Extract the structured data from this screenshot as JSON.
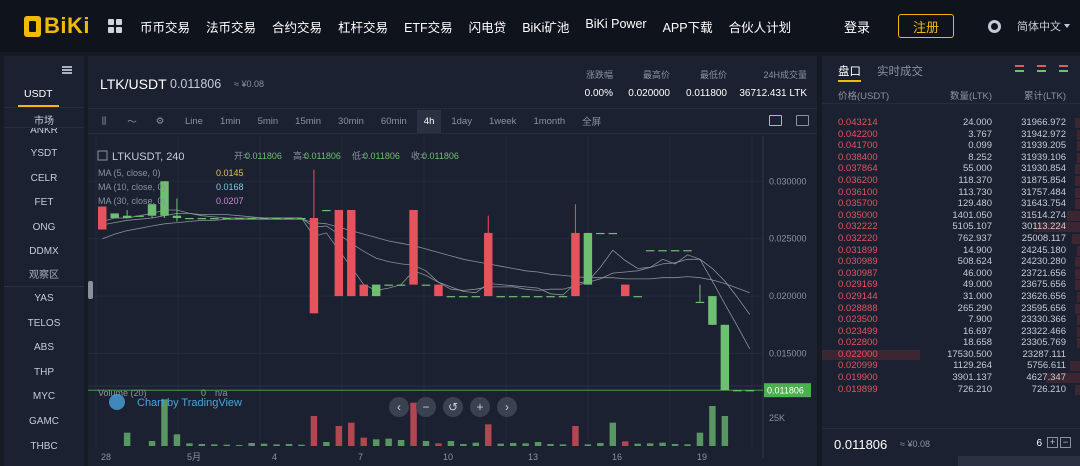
{
  "brand": {
    "name": "BiKi"
  },
  "nav": [
    "币币交易",
    "法币交易",
    "合约交易",
    "杠杆交易",
    "ETF交易",
    "闪电贷",
    "BiKi矿池",
    "BiKi Power",
    "APP下载",
    "合伙人计划"
  ],
  "header": {
    "login": "登录",
    "register": "注册",
    "language": "简体中文"
  },
  "markets": {
    "tab": "USDT",
    "section_label": "市场",
    "items": [
      "ANKR",
      "YSDT",
      "CELR",
      "FET",
      "ONG",
      "DDMX"
    ],
    "watch_label": "观察区",
    "watch_items": [
      "YAS",
      "TELOS",
      "ABS",
      "THP",
      "MYC",
      "GAMC",
      "THBC"
    ]
  },
  "ticker": {
    "pair": "LTK/USDT",
    "price": "0.011806",
    "cny": "≈ ¥0.08",
    "stats": [
      {
        "label": "涨跌幅",
        "value": "0.00%"
      },
      {
        "label": "最高价",
        "value": "0.020000"
      },
      {
        "label": "最低价",
        "value": "0.011800"
      },
      {
        "label": "24H成交量",
        "value": "36712.431 LTK"
      }
    ]
  },
  "toolbar": {
    "intervals": [
      "Line",
      "1min",
      "5min",
      "15min",
      "30min",
      "60min",
      "4h",
      "1day",
      "1week",
      "1month"
    ],
    "active": "4h",
    "fullscreen": "全屏"
  },
  "chart_legend": {
    "symbol": "LTKUSDT, 240",
    "ohlc": [
      {
        "k": "开=",
        "v": "0.011806"
      },
      {
        "k": "高=",
        "v": "0.011806"
      },
      {
        "k": "低=",
        "v": "0.011806"
      },
      {
        "k": "收=",
        "v": "0.011806"
      }
    ],
    "ma": [
      {
        "label": "MA (5, close, 0)",
        "value": "0.0145",
        "color": "#e0c35a"
      },
      {
        "label": "MA (10, close, 0)",
        "value": "0.0168",
        "color": "#7ec9e6"
      },
      {
        "label": "MA (30, close, 0)",
        "value": "0.0207",
        "color": "#c88bd9"
      }
    ],
    "volume": {
      "label": "Volume (20)",
      "value": "0",
      "na": "n/a"
    }
  },
  "chart_data": {
    "type": "candlestick",
    "y_ticks": [
      "0.030000",
      "0.025000",
      "0.020000",
      "0.015000"
    ],
    "y_values": [
      0.03,
      0.025,
      0.02,
      0.015
    ],
    "last_price": "0.011806",
    "last_price_value": 0.011806,
    "volume_tick": "25K",
    "x_ticks": [
      "28",
      "5月",
      "4",
      "7",
      "10",
      "13",
      "16",
      "19"
    ],
    "candles": [
      {
        "o": 0.0278,
        "c": 0.0258,
        "h": 0.0278,
        "l": 0.0258
      },
      {
        "o": 0.0268,
        "c": 0.0272,
        "h": 0.0272,
        "l": 0.0268
      },
      {
        "o": 0.0268,
        "c": 0.027,
        "h": 0.0275,
        "l": 0.0268
      },
      {
        "o": 0.027,
        "c": 0.027,
        "h": 0.027,
        "l": 0.027
      },
      {
        "o": 0.027,
        "c": 0.028,
        "h": 0.028,
        "l": 0.0268
      },
      {
        "o": 0.027,
        "c": 0.03,
        "h": 0.03,
        "l": 0.0268
      },
      {
        "o": 0.0268,
        "c": 0.027,
        "h": 0.0285,
        "l": 0.0265
      },
      {
        "o": 0.0268,
        "c": 0.0268,
        "h": 0.0268,
        "l": 0.0268
      },
      {
        "o": 0.0268,
        "c": 0.0268,
        "h": 0.0268,
        "l": 0.0268
      },
      {
        "o": 0.0268,
        "c": 0.0268,
        "h": 0.0268,
        "l": 0.0268
      },
      {
        "o": 0.0268,
        "c": 0.0268,
        "h": 0.0268,
        "l": 0.0268
      },
      {
        "o": 0.0268,
        "c": 0.0268,
        "h": 0.0268,
        "l": 0.0268
      },
      {
        "o": 0.0268,
        "c": 0.0268,
        "h": 0.0268,
        "l": 0.0268
      },
      {
        "o": 0.0268,
        "c": 0.0268,
        "h": 0.0268,
        "l": 0.0268
      },
      {
        "o": 0.0268,
        "c": 0.0268,
        "h": 0.0268,
        "l": 0.0268
      },
      {
        "o": 0.0268,
        "c": 0.0268,
        "h": 0.0268,
        "l": 0.0268
      },
      {
        "o": 0.0268,
        "c": 0.0268,
        "h": 0.0268,
        "l": 0.0268
      },
      {
        "o": 0.0268,
        "c": 0.0185,
        "h": 0.031,
        "l": 0.0185
      },
      {
        "o": 0.0275,
        "c": 0.0275,
        "h": 0.0275,
        "l": 0.0275
      },
      {
        "o": 0.0275,
        "c": 0.02,
        "h": 0.0275,
        "l": 0.02
      },
      {
        "o": 0.0275,
        "c": 0.02,
        "h": 0.0275,
        "l": 0.02
      },
      {
        "o": 0.021,
        "c": 0.02,
        "h": 0.021,
        "l": 0.02
      },
      {
        "o": 0.02,
        "c": 0.021,
        "h": 0.021,
        "l": 0.02
      },
      {
        "o": 0.021,
        "c": 0.021,
        "h": 0.021,
        "l": 0.021
      },
      {
        "o": 0.021,
        "c": 0.021,
        "h": 0.021,
        "l": 0.021
      },
      {
        "o": 0.0275,
        "c": 0.021,
        "h": 0.0275,
        "l": 0.021
      },
      {
        "o": 0.021,
        "c": 0.021,
        "h": 0.021,
        "l": 0.021
      },
      {
        "o": 0.021,
        "c": 0.02,
        "h": 0.021,
        "l": 0.02
      },
      {
        "o": 0.02,
        "c": 0.02,
        "h": 0.02,
        "l": 0.02
      },
      {
        "o": 0.02,
        "c": 0.02,
        "h": 0.02,
        "l": 0.02
      },
      {
        "o": 0.02,
        "c": 0.02,
        "h": 0.02,
        "l": 0.02
      },
      {
        "o": 0.0255,
        "c": 0.02,
        "h": 0.027,
        "l": 0.02
      },
      {
        "o": 0.02,
        "c": 0.02,
        "h": 0.02,
        "l": 0.02
      },
      {
        "o": 0.02,
        "c": 0.02,
        "h": 0.02,
        "l": 0.02
      },
      {
        "o": 0.02,
        "c": 0.02,
        "h": 0.02,
        "l": 0.02
      },
      {
        "o": 0.02,
        "c": 0.02,
        "h": 0.02,
        "l": 0.02
      },
      {
        "o": 0.02,
        "c": 0.02,
        "h": 0.02,
        "l": 0.02
      },
      {
        "o": 0.02,
        "c": 0.02,
        "h": 0.02,
        "l": 0.02
      },
      {
        "o": 0.0255,
        "c": 0.02,
        "h": 0.028,
        "l": 0.02
      },
      {
        "o": 0.021,
        "c": 0.0255,
        "h": 0.0255,
        "l": 0.021
      },
      {
        "o": 0.0255,
        "c": 0.0255,
        "h": 0.0255,
        "l": 0.0255
      },
      {
        "o": 0.0255,
        "c": 0.0255,
        "h": 0.0255,
        "l": 0.0255
      },
      {
        "o": 0.021,
        "c": 0.02,
        "h": 0.021,
        "l": 0.02
      },
      {
        "o": 0.02,
        "c": 0.02,
        "h": 0.02,
        "l": 0.02
      },
      {
        "o": 0.024,
        "c": 0.024,
        "h": 0.024,
        "l": 0.024
      },
      {
        "o": 0.024,
        "c": 0.024,
        "h": 0.024,
        "l": 0.024
      },
      {
        "o": 0.024,
        "c": 0.024,
        "h": 0.024,
        "l": 0.024
      },
      {
        "o": 0.024,
        "c": 0.024,
        "h": 0.024,
        "l": 0.024
      },
      {
        "o": 0.0195,
        "c": 0.0195,
        "h": 0.021,
        "l": 0.0195
      },
      {
        "o": 0.0175,
        "c": 0.02,
        "h": 0.02,
        "l": 0.0175
      },
      {
        "o": 0.01181,
        "c": 0.0175,
        "h": 0.0175,
        "l": 0.01181
      },
      {
        "o": 0.01181,
        "c": 0.01181,
        "h": 0.01181,
        "l": 0.01181
      },
      {
        "o": 0.01181,
        "c": 0.01181,
        "h": 0.01181,
        "l": 0.01181
      }
    ],
    "volumes": [
      0,
      0,
      4000,
      0,
      1500,
      14000,
      3500,
      800,
      600,
      500,
      400,
      300,
      900,
      700,
      500,
      600,
      400,
      9000,
      1200,
      6000,
      7000,
      2500,
      2000,
      2200,
      1800,
      13000,
      1500,
      800,
      1500,
      600,
      1000,
      6500,
      700,
      900,
      800,
      1200,
      600,
      500,
      6000,
      500,
      900,
      7000,
      1400,
      700,
      800,
      1000,
      600,
      500,
      4000,
      12000,
      9000,
      0,
      0
    ],
    "ma_series": [
      {
        "name": "MA5",
        "color": "#e0c35a",
        "values": [
          0.0265,
          0.0268,
          0.0268,
          0.027,
          0.0272,
          0.0275,
          0.0275,
          0.0272,
          0.027,
          0.0269,
          0.0268,
          0.0268,
          0.0268,
          0.0268,
          0.0268,
          0.0268,
          0.0268,
          0.0252,
          0.0255,
          0.024,
          0.0225,
          0.021,
          0.0205,
          0.0207,
          0.021,
          0.0222,
          0.0218,
          0.0212,
          0.0208,
          0.0204,
          0.0203,
          0.0211,
          0.021,
          0.0209,
          0.0208,
          0.0207,
          0.0202,
          0.0201,
          0.0211,
          0.0213,
          0.0225,
          0.024,
          0.0231,
          0.0224,
          0.0225,
          0.0232,
          0.0228,
          0.0236,
          0.0232,
          0.0213,
          0.0193,
          0.0174,
          0.0154
        ]
      },
      {
        "name": "MA10",
        "color": "#7ec9e6",
        "values": [
          0.0262,
          0.0264,
          0.0266,
          0.0267,
          0.0268,
          0.027,
          0.0272,
          0.0272,
          0.0271,
          0.0271,
          0.0271,
          0.027,
          0.0269,
          0.0268,
          0.0268,
          0.0268,
          0.0268,
          0.026,
          0.0261,
          0.0254,
          0.0246,
          0.0239,
          0.0233,
          0.023,
          0.0228,
          0.0227,
          0.0222,
          0.0212,
          0.0206,
          0.0205,
          0.0206,
          0.0208,
          0.0208,
          0.0208,
          0.0206,
          0.0205,
          0.0206,
          0.0206,
          0.0209,
          0.0212,
          0.0215,
          0.022,
          0.0221,
          0.0222,
          0.0225,
          0.0228,
          0.0229,
          0.0232,
          0.0232,
          0.0224,
          0.0213,
          0.0199,
          0.0184
        ]
      },
      {
        "name": "MA30",
        "color": "#c88bd9",
        "values": [
          0.025,
          0.0254,
          0.0257,
          0.0259,
          0.0261,
          0.0263,
          0.0264,
          0.0265,
          0.0266,
          0.0266,
          0.0267,
          0.0267,
          0.0267,
          0.0267,
          0.0267,
          0.0267,
          0.0267,
          0.0264,
          0.0263,
          0.026,
          0.0257,
          0.0254,
          0.0251,
          0.0248,
          0.0246,
          0.0244,
          0.0241,
          0.0238,
          0.0235,
          0.0232,
          0.023,
          0.0228,
          0.0226,
          0.0224,
          0.0222,
          0.0221,
          0.0219,
          0.0218,
          0.0217,
          0.0216,
          0.0216,
          0.0216,
          0.0215,
          0.0215,
          0.0215,
          0.0216,
          0.0216,
          0.0217,
          0.0216,
          0.0214,
          0.0211,
          0.0207,
          0.0203
        ]
      }
    ]
  },
  "watermark": "Chart by TradingView",
  "orderbook": {
    "tabs": [
      "盘口",
      "实时成交"
    ],
    "columns": [
      "价格(USDT)",
      "数量(LTK)",
      "累计(LTK)"
    ],
    "asks": [
      {
        "price": "0.043214",
        "amount": "24.000",
        "total": "31966.972",
        "depth": 0.02
      },
      {
        "price": "0.042200",
        "amount": "3.767",
        "total": "31942.972",
        "depth": 0.01
      },
      {
        "price": "0.041700",
        "amount": "0.099",
        "total": "31939.205",
        "depth": 0.01
      },
      {
        "price": "0.038400",
        "amount": "8.252",
        "total": "31939.106",
        "depth": 0.01
      },
      {
        "price": "0.037864",
        "amount": "55.000",
        "total": "31930.854",
        "depth": 0.02
      },
      {
        "price": "0.036200",
        "amount": "118.370",
        "total": "31875.854",
        "depth": 0.02
      },
      {
        "price": "0.036100",
        "amount": "113.730",
        "total": "31757.484",
        "depth": 0.02
      },
      {
        "price": "0.035700",
        "amount": "129.480",
        "total": "31643.754",
        "depth": 0.02
      },
      {
        "price": "0.035000",
        "amount": "1401.050",
        "total": "31514.274",
        "depth": 0.05
      },
      {
        "price": "0.032222",
        "amount": "5105.107",
        "total": "30113.224",
        "depth": 0.18
      },
      {
        "price": "0.032220",
        "amount": "762.937",
        "total": "25008.117",
        "depth": 0.03
      },
      {
        "price": "0.031899",
        "amount": "14.900",
        "total": "24245.180",
        "depth": 0.01
      },
      {
        "price": "0.030989",
        "amount": "508.624",
        "total": "24230.280",
        "depth": 0.02
      },
      {
        "price": "0.030987",
        "amount": "46.000",
        "total": "23721.656",
        "depth": 0.02
      },
      {
        "price": "0.029169",
        "amount": "49.000",
        "total": "23675.656",
        "depth": 0.02
      },
      {
        "price": "0.029144",
        "amount": "31.000",
        "total": "23626.656",
        "depth": 0.01
      },
      {
        "price": "0.028888",
        "amount": "265.290",
        "total": "23595.656",
        "depth": 0.02
      },
      {
        "price": "0.023500",
        "amount": "7.900",
        "total": "23330.366",
        "depth": 0.01
      },
      {
        "price": "0.023499",
        "amount": "16.697",
        "total": "23322.466",
        "depth": 0.01
      },
      {
        "price": "0.022800",
        "amount": "18.658",
        "total": "23305.769",
        "depth": 0.01
      },
      {
        "price": "0.022000",
        "amount": "17530.500",
        "total": "23287.111",
        "depth": 0.6
      },
      {
        "price": "0.020999",
        "amount": "1129.264",
        "total": "5756.611",
        "depth": 0.04
      },
      {
        "price": "0.019900",
        "amount": "3901.137",
        "total": "4627.347",
        "depth": 0.13
      },
      {
        "price": "0.019899",
        "amount": "726.210",
        "total": "726.210",
        "depth": 0.02
      }
    ],
    "last_price": "0.011806",
    "last_cny": "≈ ¥0.08",
    "decimals": "6"
  }
}
